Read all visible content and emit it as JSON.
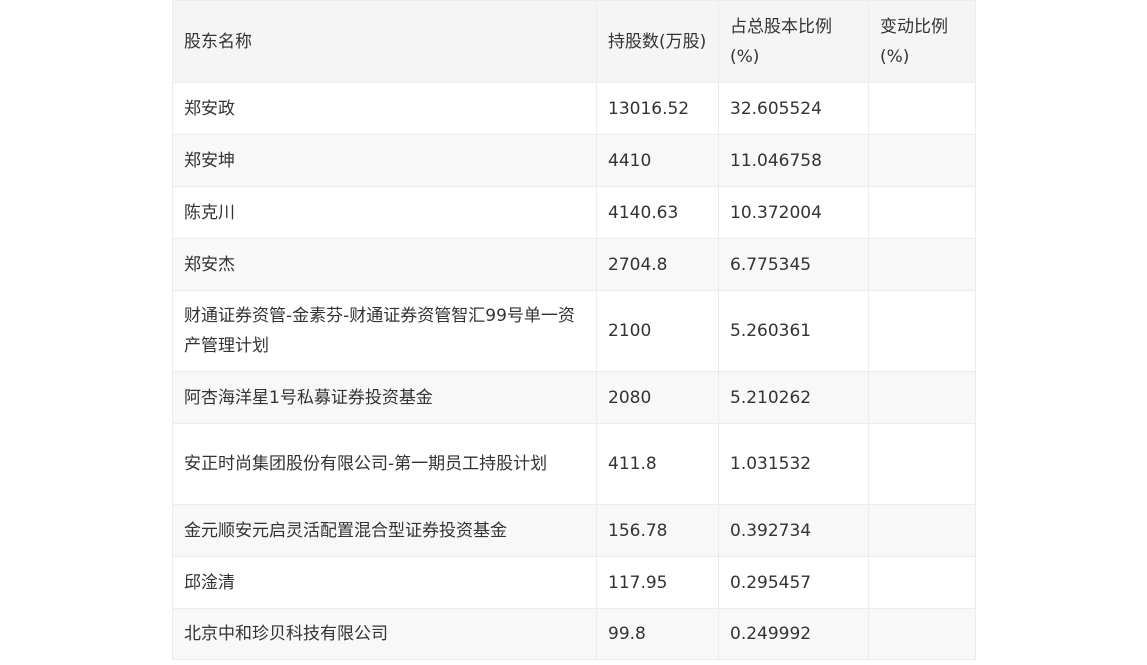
{
  "table": {
    "headers": [
      "股东名称",
      "持股数(万股)",
      "占总股本比例(%)",
      "变动比例(%)"
    ],
    "rows": [
      {
        "name": "郑安政",
        "shares": "13016.52",
        "ratio": "32.605524",
        "change": ""
      },
      {
        "name": "郑安坤",
        "shares": "4410",
        "ratio": "11.046758",
        "change": ""
      },
      {
        "name": "陈克川",
        "shares": "4140.63",
        "ratio": "10.372004",
        "change": ""
      },
      {
        "name": "郑安杰",
        "shares": "2704.8",
        "ratio": "6.775345",
        "change": ""
      },
      {
        "name": "财通证券资管-金素芬-财通证券资管智汇99号单一资产管理计划",
        "shares": "2100",
        "ratio": "5.260361",
        "change": ""
      },
      {
        "name": "阿杏海洋星1号私募证券投资基金",
        "shares": "2080",
        "ratio": "5.210262",
        "change": ""
      },
      {
        "name": "安正时尚集团股份有限公司-第一期员工持股计划",
        "shares": "411.8",
        "ratio": "1.031532",
        "change": ""
      },
      {
        "name": "金元顺安元启灵活配置混合型证券投资基金",
        "shares": "156.78",
        "ratio": "0.392734",
        "change": ""
      },
      {
        "name": "邱淦清",
        "shares": "117.95",
        "ratio": "0.295457",
        "change": ""
      },
      {
        "name": "北京中和珍贝科技有限公司",
        "shares": "99.8",
        "ratio": "0.249992",
        "change": ""
      }
    ]
  }
}
